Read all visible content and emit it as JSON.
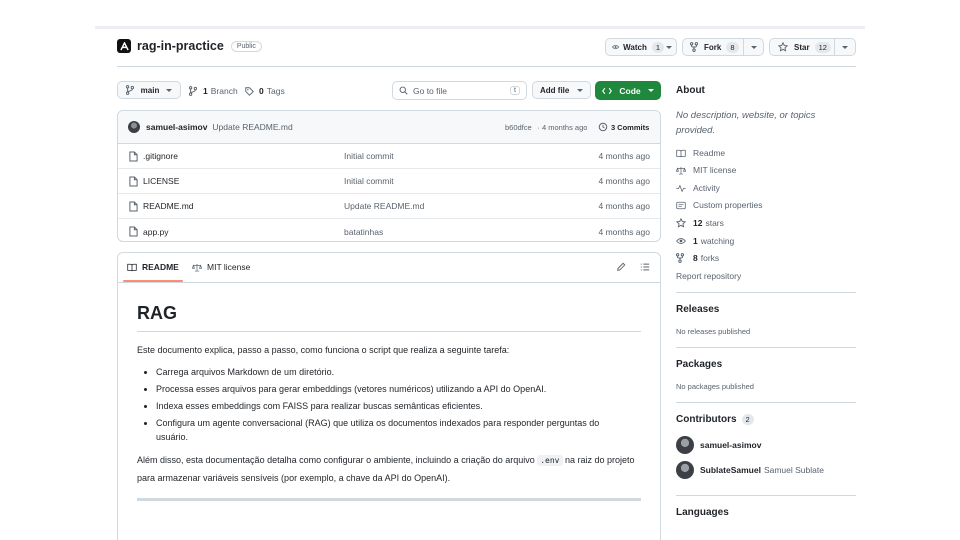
{
  "repo": {
    "name": "rag-in-practice",
    "visibility": "Public"
  },
  "actions": {
    "watch_label": "Watch",
    "watch_count": "1",
    "fork_label": "Fork",
    "fork_count": "8",
    "star_label": "Star",
    "star_count": "12"
  },
  "toolbar": {
    "branch": "main",
    "branches_count": "1",
    "branches_label": "Branch",
    "tags_count": "0",
    "tags_label": "Tags",
    "goto_placeholder": "Go to file",
    "goto_key": "t",
    "add_file": "Add file",
    "code": "Code"
  },
  "commit": {
    "author": "samuel-asimov",
    "message": "Update README.md",
    "hash": "b60dfce",
    "sep": "·",
    "time": "4 months ago",
    "commits_count": "3",
    "commits_label": "Commits"
  },
  "files": [
    {
      "name": ".gitignore",
      "message": "Initial commit",
      "time": "4 months ago",
      "icon": "file-icon"
    },
    {
      "name": "LICENSE",
      "message": "Initial commit",
      "time": "4 months ago",
      "icon": "file-icon"
    },
    {
      "name": "README.md",
      "message": "Update README.md",
      "time": "4 months ago",
      "icon": "file-icon"
    },
    {
      "name": "app.py",
      "message": "batatinhas",
      "time": "4 months ago",
      "icon": "file-icon"
    }
  ],
  "readme": {
    "tab_readme": "README",
    "tab_license": "MIT license",
    "title": "RAG",
    "intro": "Este documento explica, passo a passo, como funciona o script que realiza a seguinte tarefa:",
    "bullets": [
      "Carrega arquivos Markdown de um diretório.",
      "Processa esses arquivos para gerar embeddings (vetores numéricos) utilizando a API do OpenAI.",
      "Indexa esses embeddings com FAISS para realizar buscas semânticas eficientes.",
      "Configura um agente conversacional (RAG) que utiliza os documentos indexados para responder perguntas do usuário."
    ],
    "outro_before": "Além disso, esta documentação detalha como configurar o ambiente, incluindo a criação do arquivo ",
    "outro_code": ".env",
    "outro_after": " na raiz do projeto para armazenar variáveis sensíveis (por exemplo, a chave da API do OpenAI)."
  },
  "about": {
    "heading": "About",
    "description": "No description, website, or topics provided.",
    "readme": "Readme",
    "license": "MIT license",
    "activity": "Activity",
    "custom_properties": "Custom properties",
    "stars_count": "12",
    "stars_label": "stars",
    "watching_count": "1",
    "watching_label": "watching",
    "forks_count": "8",
    "forks_label": "forks",
    "report": "Report repository"
  },
  "releases": {
    "heading": "Releases",
    "empty": "No releases published"
  },
  "packages": {
    "heading": "Packages",
    "empty": "No packages published"
  },
  "contributors": {
    "heading": "Contributors",
    "count": "2",
    "list": [
      {
        "login": "samuel-asimov",
        "name": ""
      },
      {
        "login": "SublateSamuel",
        "name": "Samuel Sublate"
      }
    ]
  },
  "languages": {
    "heading": "Languages"
  },
  "colors": {
    "code_button": "#1f883d",
    "link": "#0969da",
    "muted": "#59636e",
    "border": "#d1d9e0"
  }
}
